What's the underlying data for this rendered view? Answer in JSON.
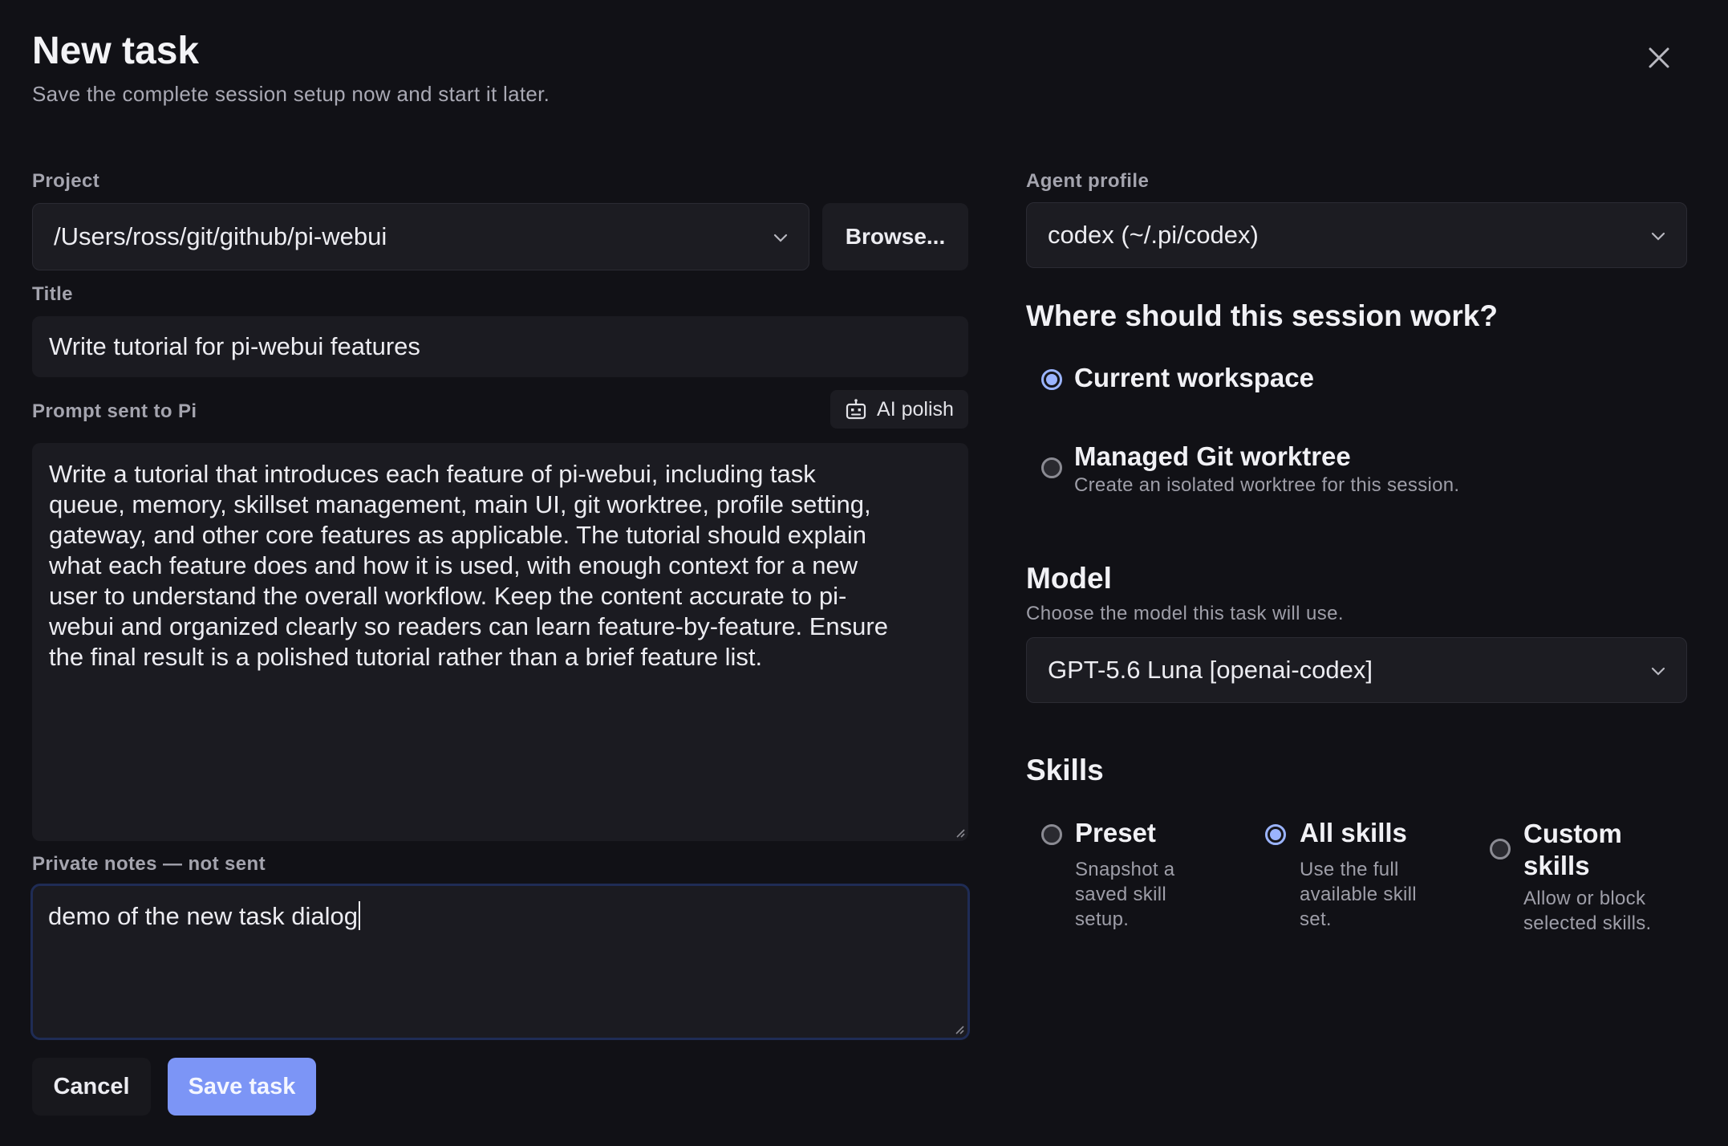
{
  "dialog": {
    "title": "New task",
    "subtitle": "Save the complete session setup now and start it later."
  },
  "project": {
    "label": "Project",
    "value": "/Users/ross/git/github/pi-webui",
    "browse_label": "Browse..."
  },
  "title_field": {
    "label": "Title",
    "value": "Write tutorial for pi-webui features"
  },
  "prompt": {
    "label": "Prompt sent to Pi",
    "ai_polish_label": "AI polish",
    "lines": [
      "Write a tutorial that introduces each feature of pi-webui, including task",
      "queue, memory, skillset management, main UI, git worktree, profile setting,",
      "gateway, and other core features as applicable. The tutorial should explain",
      "what each feature does and how it is used, with enough context for a new",
      "user to understand the overall workflow. Keep the content accurate to pi-",
      "webui and organized clearly so readers can learn feature-by-feature. Ensure",
      "the final result is a polished tutorial rather than a brief feature list."
    ]
  },
  "notes": {
    "label": "Private notes — not sent",
    "value": "demo of the new task dialog"
  },
  "actions": {
    "cancel_label": "Cancel",
    "save_label": "Save task"
  },
  "agent_profile": {
    "label": "Agent profile",
    "value": "codex (~/.pi/codex)"
  },
  "workspace": {
    "heading": "Where should this session work?",
    "options": [
      {
        "title": "Current workspace",
        "desc": "",
        "selected": true
      },
      {
        "title": "Managed Git worktree",
        "desc": "Create an isolated worktree for this session.",
        "selected": false
      }
    ]
  },
  "model": {
    "heading": "Model",
    "hint": "Choose the model this task will use.",
    "value": "GPT-5.6 Luna [openai-codex]"
  },
  "skills": {
    "heading": "Skills",
    "options": [
      {
        "title": "Preset",
        "desc_lines": [
          "Snapshot a",
          "saved skill",
          "setup."
        ],
        "selected": false
      },
      {
        "title": "All skills",
        "desc_lines": [
          "Use the full",
          "available skill",
          "set."
        ],
        "selected": true
      },
      {
        "title_lines": [
          "Custom",
          "skills"
        ],
        "desc_lines": [
          "Allow or block",
          "selected skills."
        ],
        "selected": false
      }
    ]
  },
  "icons": {
    "close": "close-icon",
    "chevron": "chevron-down-icon",
    "robot": "robot-icon",
    "resize": "resize-grip-icon"
  },
  "colors": {
    "background": "#111116",
    "field": "#1c1c22",
    "accent": "#7c95f6",
    "radio_on": "#9bb4ff",
    "focus_border": "#1f2c55"
  }
}
